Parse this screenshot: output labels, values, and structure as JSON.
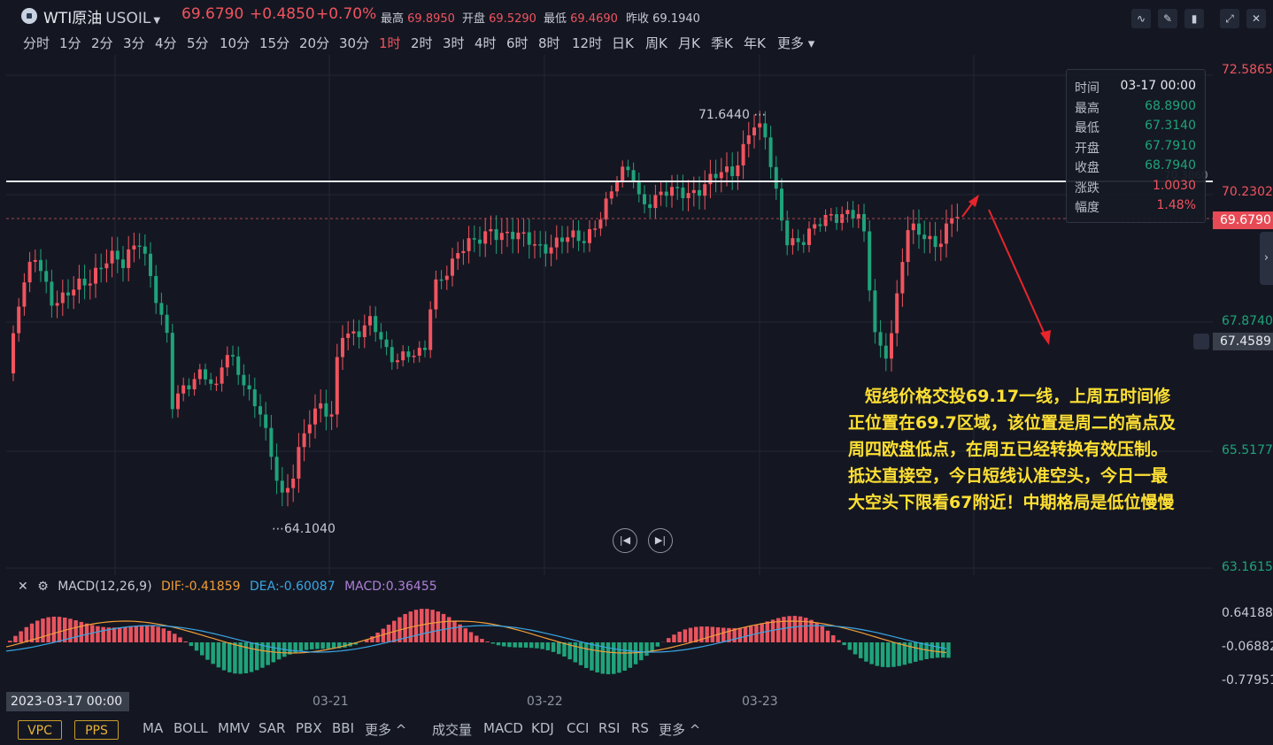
{
  "header": {
    "name": "WTI原油",
    "code": "USOIL",
    "price": "69.6790",
    "change": "+0.4850",
    "change_pct": "+0.70%",
    "stats": [
      {
        "label": "最高",
        "value": "69.8950"
      },
      {
        "label": "开盘",
        "value": "69.5290"
      },
      {
        "label": "最低",
        "value": "69.4690"
      },
      {
        "label": "昨收",
        "value": "69.1940"
      }
    ]
  },
  "periods": [
    "分时",
    "1分",
    "2分",
    "3分",
    "4分",
    "5分",
    "10分",
    "15分",
    "20分",
    "30分",
    "1时",
    "2时",
    "3时",
    "4时",
    "6时",
    "8时",
    "12时",
    "日K",
    "周K",
    "月K",
    "季K",
    "年K",
    "更多"
  ],
  "active_period": "1时",
  "y_axis": {
    "labels": [
      "72.5865",
      "70.2302",
      "67.8740",
      "65.5177",
      "63.1615"
    ],
    "current_price": "69.6790",
    "crosshair_price": "67.4589",
    "line_price": "70.3860"
  },
  "tooltip": {
    "rows": [
      {
        "k": "时间",
        "v": "03-17 00:00"
      },
      {
        "k": "最高",
        "v": "68.8900"
      },
      {
        "k": "最低",
        "v": "67.3140"
      },
      {
        "k": "开盘",
        "v": "67.7910"
      },
      {
        "k": "收盘",
        "v": "68.7940"
      },
      {
        "k": "涨跌",
        "v": "1.0030"
      },
      {
        "k": "幅度",
        "v": "1.48%"
      }
    ]
  },
  "chart_marks": {
    "high": "71.6440",
    "low": "64.1040"
  },
  "annotation": "短线价格交投69.17一线，上周五时间修正位置在69.7区域，该位置是周二的高点及周四欧盘低点，在周五已经转换有效压制。抵达直接空，今日短线认准空头，今日一最大空头下限看67附近！中期格局是低位慢慢",
  "macd": {
    "name": "MACD(12,26,9)",
    "dif": "DIF:-0.41859",
    "dea": "DEA:-0.60087",
    "macd": "MACD:0.36455",
    "axis": [
      "0.64188",
      "-0.06882",
      "-0.77951"
    ]
  },
  "dates": {
    "cursor": "2023-03-17 00:00",
    "labels": [
      "03-21",
      "03-22",
      "03-23"
    ]
  },
  "bottom": {
    "boxes": [
      "VPC",
      "PPS"
    ],
    "main_ind": [
      "MA",
      "BOLL",
      "MMV",
      "SAR",
      "PBX",
      "BBI",
      "更多 ^"
    ],
    "sub_ind": [
      "成交量",
      "MACD",
      "KDJ",
      "CCI",
      "RSI",
      "RS",
      "更多 ^"
    ]
  },
  "colors": {
    "up": "#f0545e",
    "down": "#1fa37a",
    "bg": "#141722",
    "annot": "#ffe033"
  }
}
